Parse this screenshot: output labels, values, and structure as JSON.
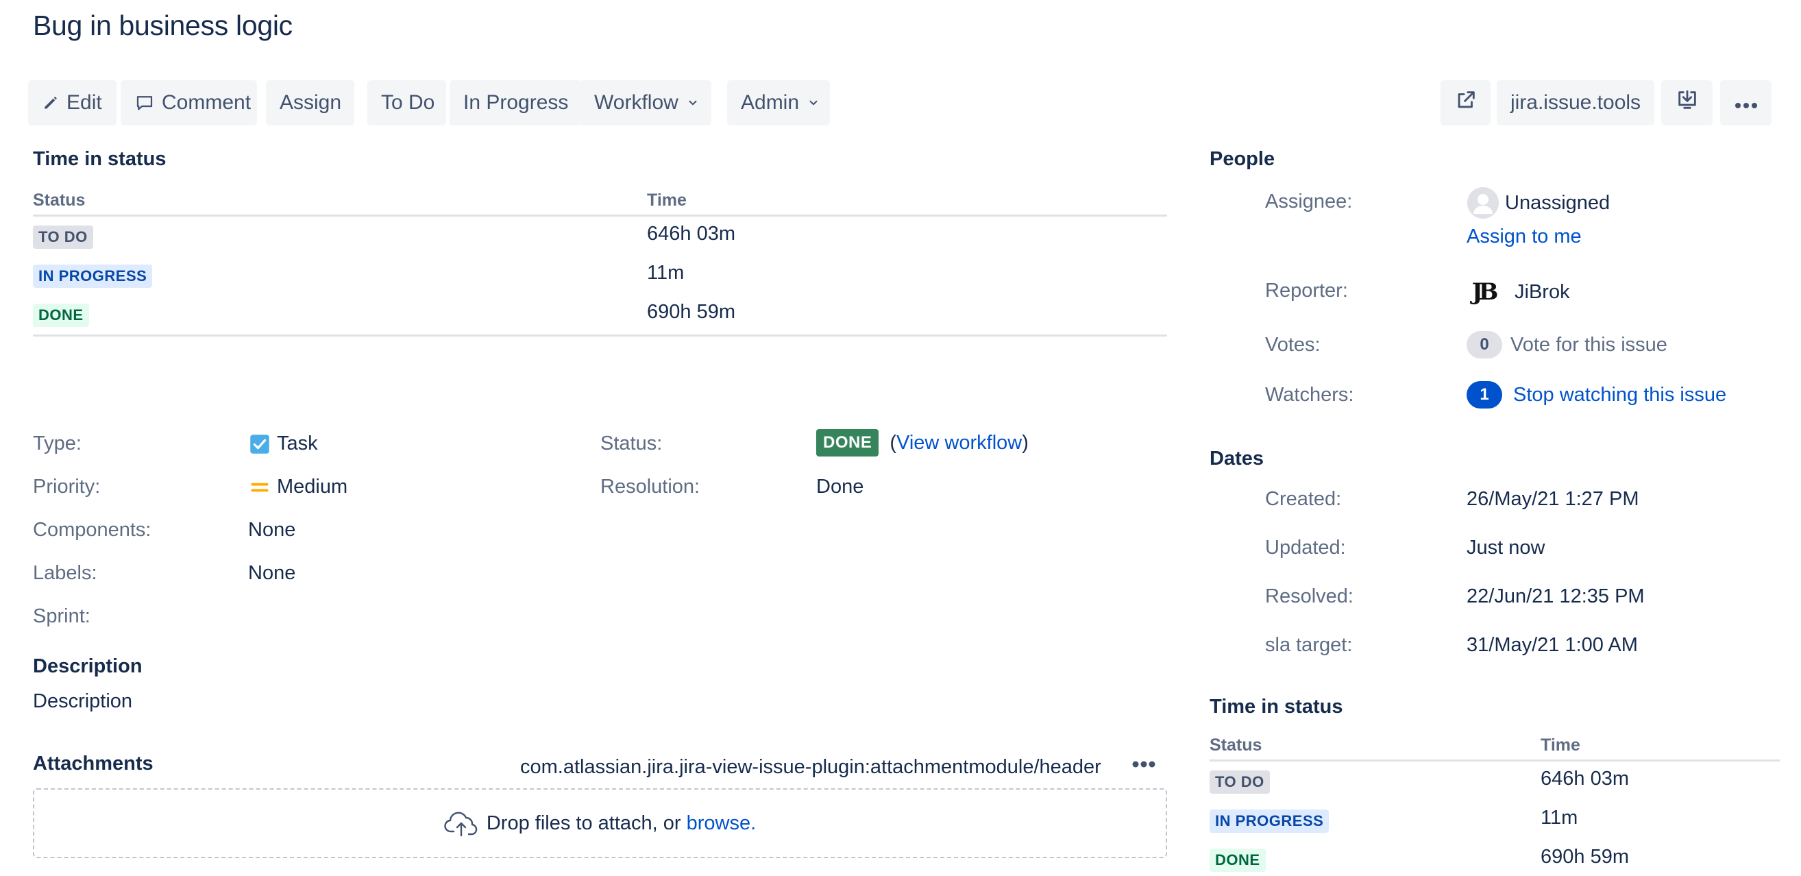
{
  "issue": {
    "title": "Bug in business logic"
  },
  "toolbar": {
    "edit": "Edit",
    "comment": "Comment",
    "assign": "Assign",
    "todo": "To Do",
    "in_progress": "In Progress",
    "workflow": "Workflow",
    "admin": "Admin",
    "tools": "jira.issue.tools",
    "icons": [
      "pencil-icon",
      "comment-icon",
      "chevron-down-icon",
      "share-icon",
      "export-icon",
      "more-icon"
    ]
  },
  "time_in_status": {
    "heading": "Time in status",
    "col_status": "Status",
    "col_time": "Time",
    "rows": [
      {
        "status": "TO DO",
        "time": "646h 03m"
      },
      {
        "status": "IN PROGRESS",
        "time": "11m"
      },
      {
        "status": "DONE",
        "time": "690h 59m"
      }
    ]
  },
  "details": {
    "type_label": "Type:",
    "type_value": "Task",
    "priority_label": "Priority:",
    "priority_value": "Medium",
    "components_label": "Components:",
    "components_value": "None",
    "labels_label": "Labels:",
    "labels_value": "None",
    "sprint_label": "Sprint:",
    "status_label": "Status:",
    "status_value": "DONE",
    "view_workflow_open": "(",
    "view_workflow": "View workflow",
    "view_workflow_close": ")",
    "resolution_label": "Resolution:",
    "resolution_value": "Done"
  },
  "description": {
    "heading": "Description",
    "text": "Description"
  },
  "attachments": {
    "heading": "Attachments",
    "module_key": "com.atlassian.jira.jira-view-issue-plugin:attachmentmodule/header",
    "drop_text": "Drop files to attach, or ",
    "browse": "browse."
  },
  "people": {
    "heading": "People",
    "assignee_label": "Assignee:",
    "assignee_value": "Unassigned",
    "assign_to_me": "Assign to me",
    "reporter_label": "Reporter:",
    "reporter_value": "JiBrok",
    "reporter_avatar_text": "JB",
    "votes_label": "Votes:",
    "votes_count": "0",
    "votes_action": "Vote for this issue",
    "watchers_label": "Watchers:",
    "watchers_count": "1",
    "watchers_action": "Stop watching this issue"
  },
  "dates": {
    "heading": "Dates",
    "created_label": "Created:",
    "created_value": "26/May/21 1:27 PM",
    "updated_label": "Updated:",
    "updated_value": "Just now",
    "resolved_label": "Resolved:",
    "resolved_value": "22/Jun/21 12:35 PM",
    "sla_label": "sla target:",
    "sla_value": "31/May/21 1:00 AM"
  },
  "colors": {
    "link": "#0052cc",
    "done_green": "#36845b",
    "text": "#172b4d",
    "muted": "#5e6c84",
    "button_bg": "#f4f5f7"
  }
}
